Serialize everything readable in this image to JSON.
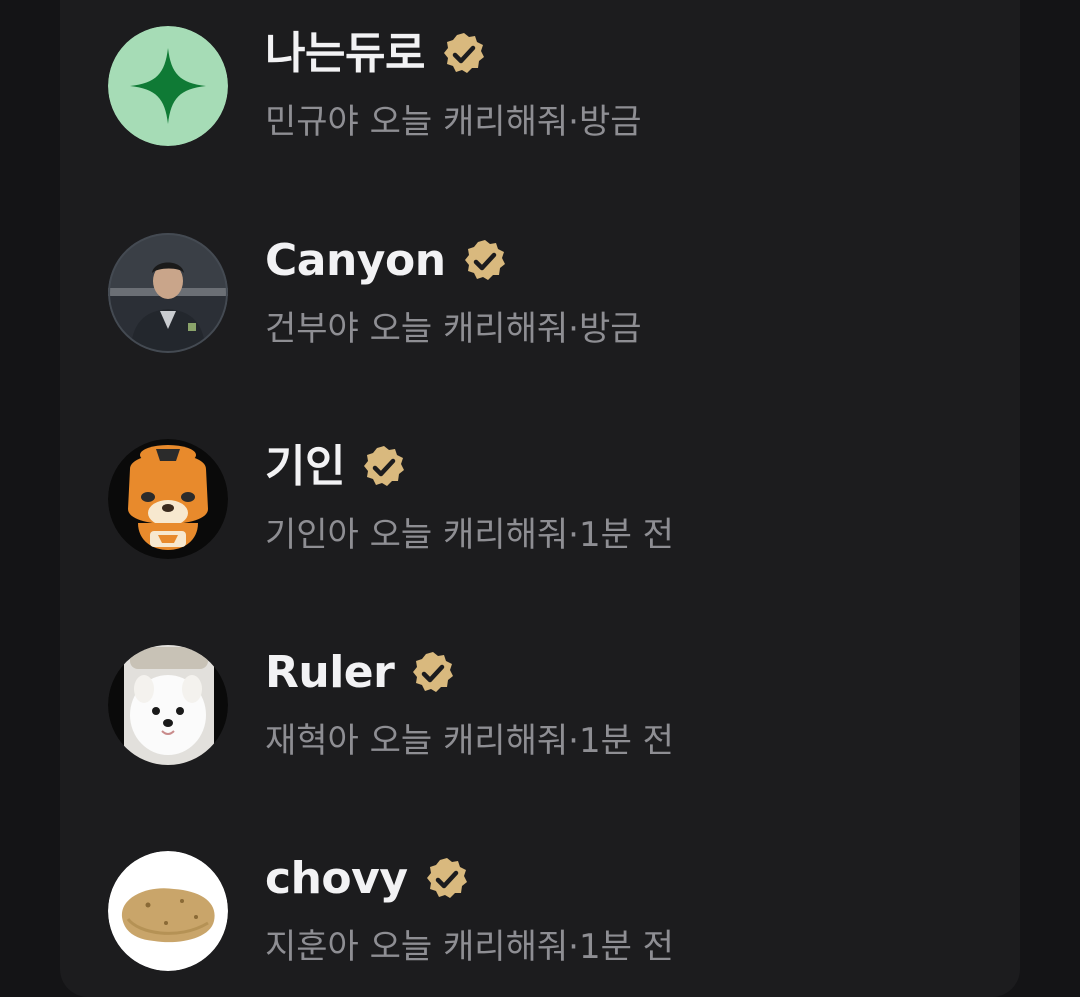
{
  "colors": {
    "background": "#141416",
    "card": "#1c1c1e",
    "name_text": "#f2f2f4",
    "sub_text": "#8e8e93",
    "verified_badge": "#d9b97e"
  },
  "users": [
    {
      "name": "나는듀로",
      "message": "민규야 오늘 캐리해줘",
      "separator": "·",
      "time": "방금",
      "avatar": "green-sparkle-avatar",
      "badge": "verified-badge-icon"
    },
    {
      "name": "Canyon",
      "message": "건부야 오늘 캐리해줘",
      "separator": "·",
      "time": "방금",
      "avatar": "person-photo-avatar",
      "badge": "verified-badge-icon"
    },
    {
      "name": "기인",
      "message": "기인아 오늘 캐리해줘",
      "separator": "·",
      "time": "1분 전",
      "avatar": "tiger-mascot-avatar",
      "badge": "verified-badge-icon"
    },
    {
      "name": "Ruler",
      "message": "재혁아 오늘 캐리해줘",
      "separator": "·",
      "time": "1분 전",
      "avatar": "white-puppy-avatar",
      "badge": "verified-badge-icon"
    },
    {
      "name": "chovy",
      "message": "지훈아 오늘 캐리해줘",
      "separator": "·",
      "time": "1분 전",
      "avatar": "potato-avatar",
      "badge": "verified-badge-icon"
    }
  ]
}
